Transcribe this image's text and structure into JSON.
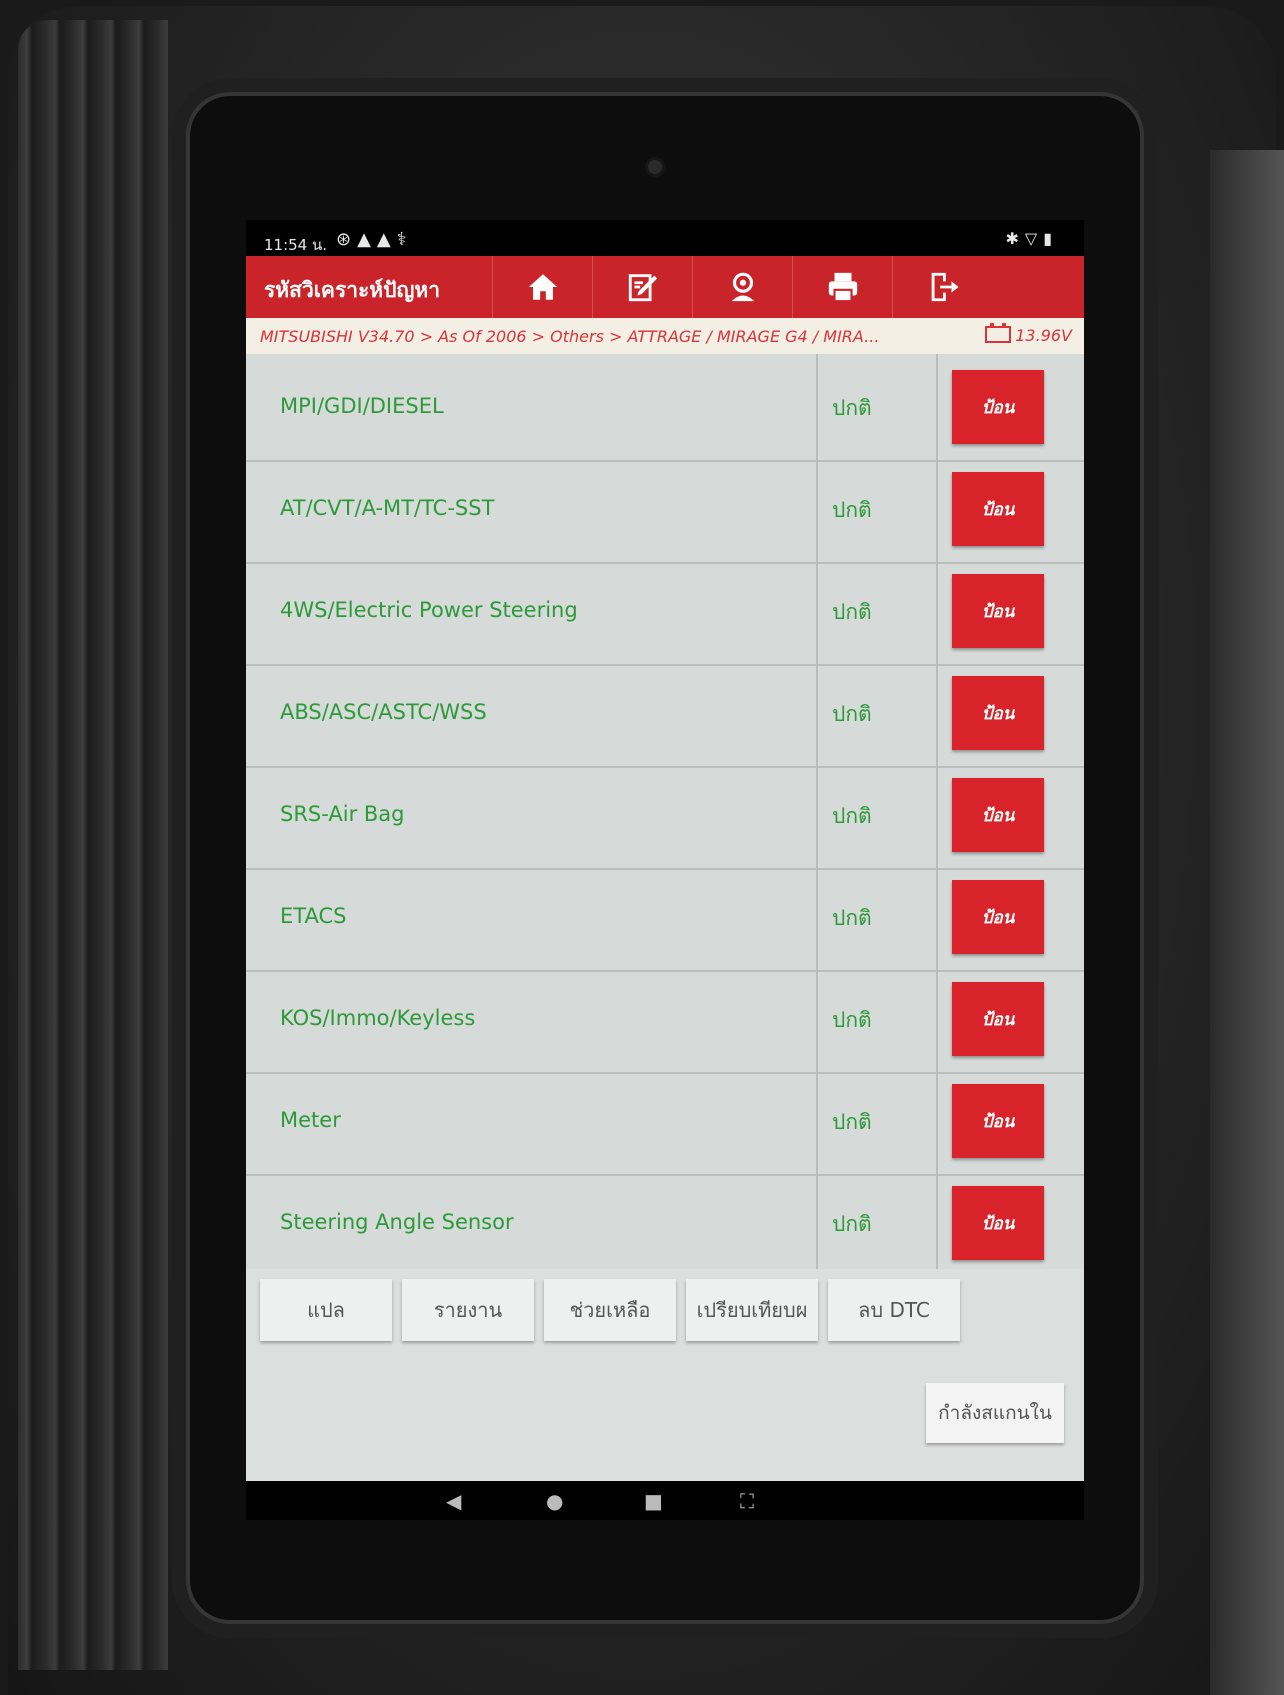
{
  "status_bar": {
    "time": "11:54 น."
  },
  "app_header": {
    "title": "รหัสวิเคราะห์ปัญหา"
  },
  "toolbar": [
    "home-icon",
    "edit-icon",
    "profile-icon",
    "print-icon",
    "exit-icon"
  ],
  "breadcrumb": {
    "path": "MITSUBISHI V34.70 > As Of 2006 > Others > ATTRAGE / MIRAGE G4 / MIRA...",
    "voltage": "13.96V"
  },
  "systems": [
    {
      "name": "MPI/GDI/DIESEL",
      "status": "ปกติ",
      "action": "ป้อน"
    },
    {
      "name": "AT/CVT/A-MT/TC-SST",
      "status": "ปกติ",
      "action": "ป้อน"
    },
    {
      "name": "4WS/Electric Power Steering",
      "status": "ปกติ",
      "action": "ป้อน"
    },
    {
      "name": "ABS/ASC/ASTC/WSS",
      "status": "ปกติ",
      "action": "ป้อน"
    },
    {
      "name": "SRS-Air Bag",
      "status": "ปกติ",
      "action": "ป้อน"
    },
    {
      "name": "ETACS",
      "status": "ปกติ",
      "action": "ป้อน"
    },
    {
      "name": "KOS/Immo/Keyless",
      "status": "ปกติ",
      "action": "ป้อน"
    },
    {
      "name": "Meter",
      "status": "ปกติ",
      "action": "ป้อน"
    },
    {
      "name": "Steering Angle Sensor",
      "status": "ปกติ",
      "action": "ป้อน"
    }
  ],
  "footer_buttons": {
    "translate": "แปล",
    "report": "รายงาน",
    "help": "ช่วยเหลือ",
    "compare": "เปรียบเทียบผ",
    "clear_dtc": "ลบ DTC",
    "scanning": "กำลังสแกนใน"
  },
  "colors": {
    "header": "#c8242a",
    "accent_red": "#d8232a",
    "system_text": "#2d9a3a"
  }
}
